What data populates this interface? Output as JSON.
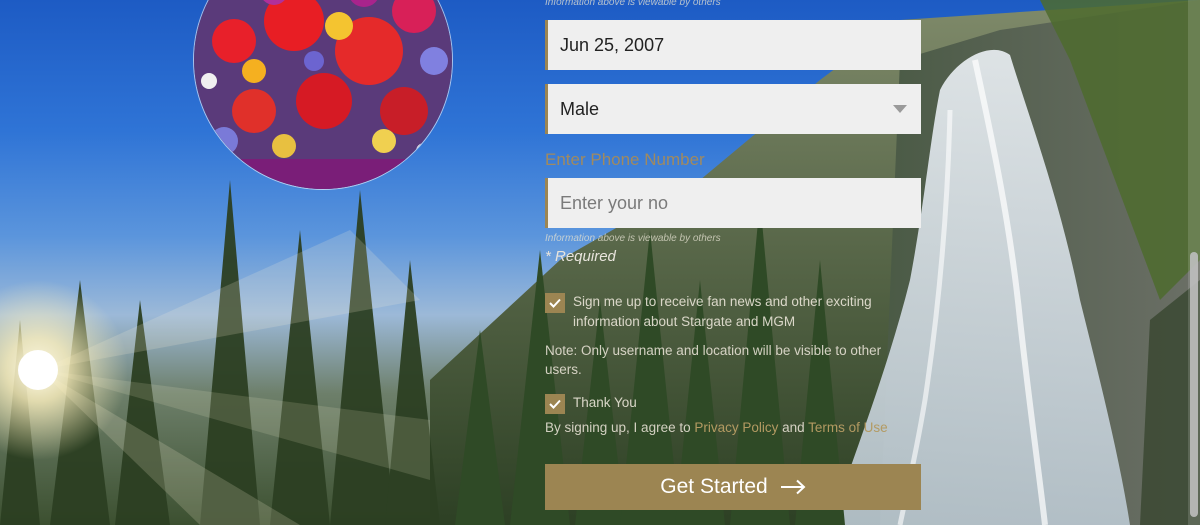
{
  "form": {
    "top_note": "Information above is viewable by others",
    "birthdate_value": "Jun 25, 2007",
    "gender_value": "Male",
    "phone_label": "Enter Phone Number",
    "phone_placeholder": "Enter your no",
    "phone_note": "Information above is viewable by others",
    "required_label": "* Required",
    "newsletter_label": "Sign me up to receive fan news and other exciting information about Stargate and MGM",
    "visibility_note": "Note: Only username and location will be visible to other users.",
    "thank_you_label": "Thank You",
    "terms_prefix": "By signing up, I agree to ",
    "privacy_link": "Privacy Policy",
    "terms_and": " and ",
    "terms_link": "Terms of Use",
    "submit_label": "Get Started"
  },
  "icons": {
    "check": "check-icon",
    "caret": "caret-down-icon",
    "arrow": "arrow-right-icon"
  },
  "colors": {
    "accent": "#9c8552",
    "field_bg": "#efefef"
  }
}
